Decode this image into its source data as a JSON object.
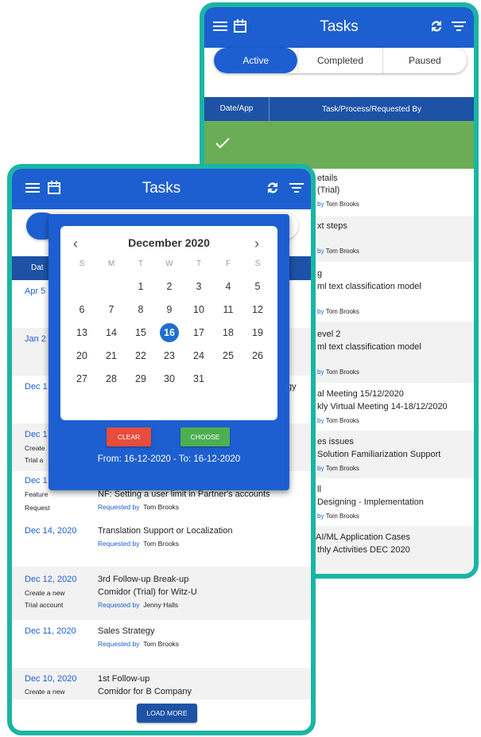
{
  "app": {
    "title": "Tasks"
  },
  "icons": {
    "menu": "menu-icon",
    "calendar": "calendar-icon",
    "sync": "sync-icon",
    "filter": "filter-icon",
    "check": "check-icon"
  },
  "colors": {
    "primary": "#1d5fd0",
    "frame": "#1ab5a3",
    "success_row": "#6aad56",
    "clear": "#e74c3c",
    "choose": "#4caf50"
  },
  "back": {
    "tabs": [
      "Active",
      "Completed",
      "Paused"
    ],
    "columns": [
      "Date/App",
      "Task/Process/Requested By"
    ],
    "rows": [
      {
        "lines": [
          "etails",
          "(Trial)"
        ],
        "req_by": "by",
        "req_name": "Tom Brooks"
      },
      {
        "lines": [
          "xt steps"
        ],
        "req_by": "by",
        "req_name": "Tom Brooks"
      },
      {
        "lines": [
          "g",
          "ml text classification model"
        ],
        "req_by": "by",
        "req_name": "Tom Brooks"
      },
      {
        "lines": [
          "evel 2",
          "ml text classification model"
        ],
        "req_by": "by",
        "req_name": "Tom Brooks"
      },
      {
        "lines": [
          "al Meeting 15/12/2020",
          "kly Virtual Meeting 14-18/12/2020"
        ],
        "req_by": "by",
        "req_name": "Tom Brooks"
      },
      {
        "lines": [
          "es issues",
          "Solution Familiarization Support"
        ],
        "req_by": "by",
        "req_name": "Tom Brooks"
      },
      {
        "lines": [
          "ll",
          "Designing - Implementation"
        ],
        "req_by": "by",
        "req_name": "Tom Brooks"
      },
      {
        "lines": [
          "AI/ML Application Cases",
          "thly Activities DEC 2020"
        ]
      }
    ]
  },
  "front": {
    "column_peek": "Dat",
    "peek_dates": [
      "Apr 5",
      "Jan 2",
      "Dec 1",
      "Dec 1",
      "Dec 1"
    ],
    "peek_sub": [
      "Create",
      "Trial a"
    ],
    "peek_right": "gy",
    "rows": [
      {
        "date": "",
        "sub": [
          "Feature",
          "Request"
        ],
        "title": "NF: Setting a user limit in Partner's accounts",
        "req_by": "Requested by",
        "req_name": "Tom Brooks"
      },
      {
        "date": "Dec 14, 2020",
        "sub": [],
        "title": "Translation Support or Localization",
        "req_by": "Requested by",
        "req_name": "Tom Brooks"
      },
      {
        "date": "Dec 12, 2020",
        "sub": [
          "Create a new",
          "Trial account"
        ],
        "title": "3rd Follow-up Break-up",
        "title2": "Comidor (Trial) for Witz-U",
        "req_by": "Requested by",
        "req_name": "Jenny Halls"
      },
      {
        "date": "Dec 11, 2020",
        "sub": [],
        "title": "Sales Strategy",
        "req_by": "Requested by",
        "req_name": "Tom Brooks"
      },
      {
        "date": "Dec 10, 2020",
        "sub": [
          "Create a new"
        ],
        "title": "1st Follow-up",
        "title2": "Comidor for B Company"
      }
    ],
    "load_more": "LOAD MORE"
  },
  "datepicker": {
    "month": "December 2020",
    "weekdays": [
      "S",
      "M",
      "T",
      "W",
      "T",
      "F",
      "S"
    ],
    "selected_day": "16",
    "clear": "CLEAR",
    "choose": "CHOOSE",
    "range": "From: 16-12-2020 - To: 16-12-2020",
    "weeks": [
      [
        "",
        "",
        "1",
        "2",
        "3",
        "4",
        "5"
      ],
      [
        "6",
        "7",
        "8",
        "9",
        "10",
        "11",
        "12"
      ],
      [
        "13",
        "14",
        "15",
        "16",
        "17",
        "18",
        "19"
      ],
      [
        "20",
        "21",
        "22",
        "23",
        "24",
        "25",
        "26"
      ],
      [
        "27",
        "28",
        "29",
        "30",
        "31",
        "",
        ""
      ]
    ]
  }
}
